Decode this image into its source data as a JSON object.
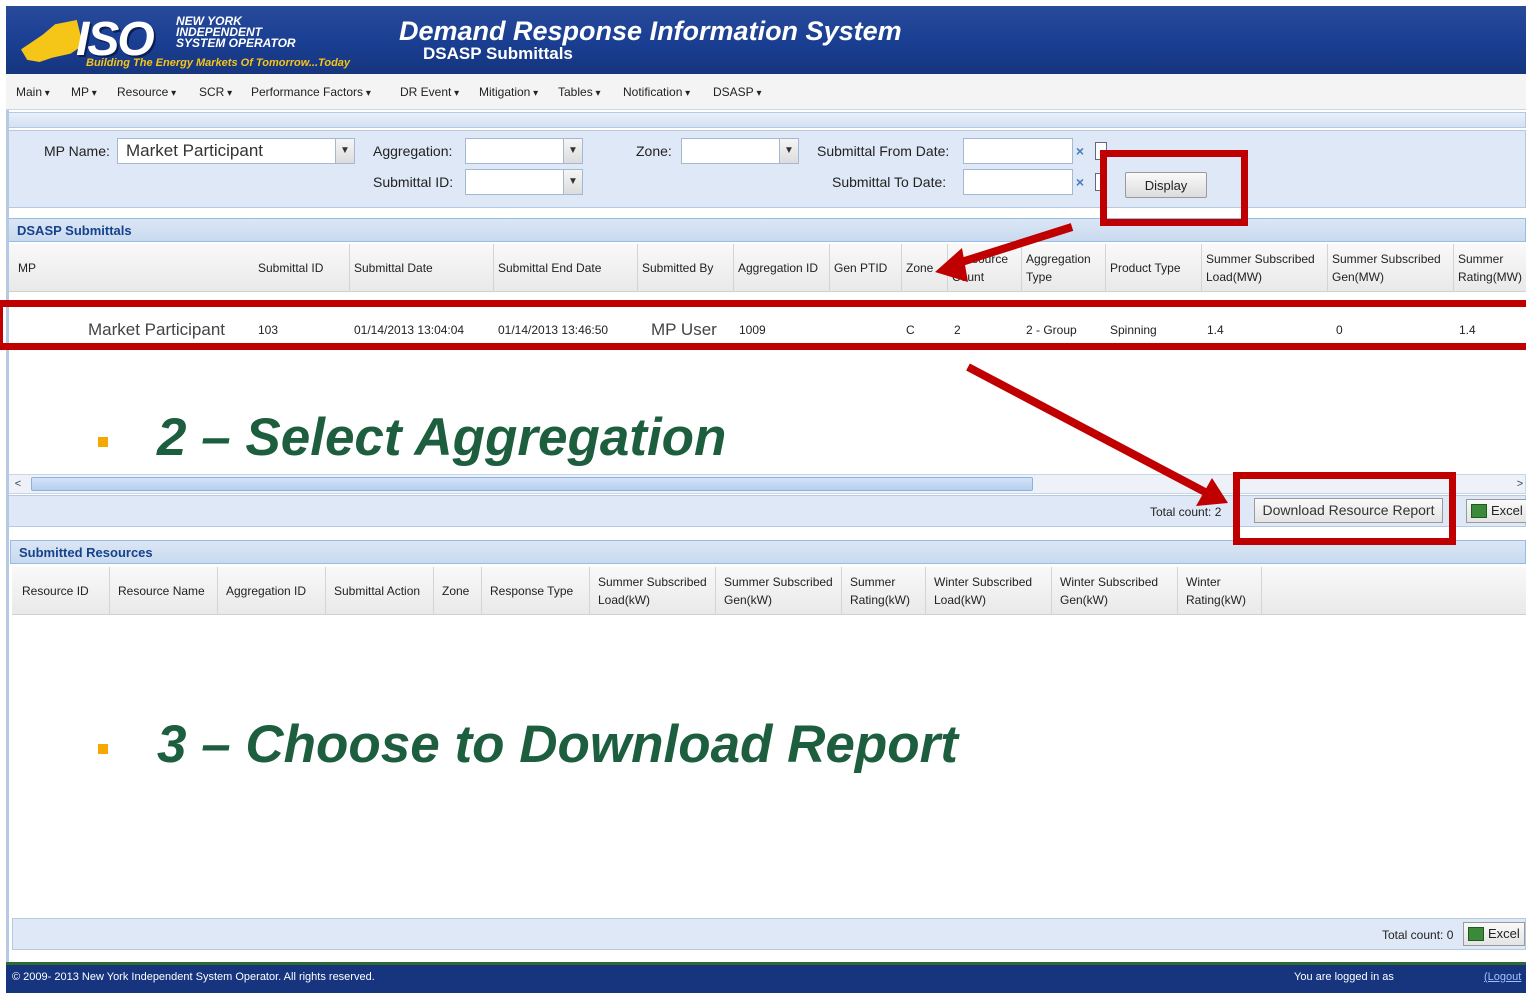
{
  "header": {
    "logo_text": "ISO",
    "logo_org_line1": "NEW YORK",
    "logo_org_line2": "INDEPENDENT",
    "logo_org_line3": "SYSTEM OPERATOR",
    "logo_tagline": "Building The Energy Markets Of Tomorrow...Today",
    "title": "Demand Response Information System",
    "subtitle": "DSASP Submittals"
  },
  "menu": [
    "Main",
    "MP",
    "Resource",
    "SCR",
    "Performance Factors",
    "DR Event",
    "Mitigation",
    "Tables",
    "Notification",
    "DSASP"
  ],
  "filters": {
    "mp_name_label": "MP Name:",
    "mp_name_value": "Market Participant",
    "aggregation_label": "Aggregation:",
    "aggregation_value": "",
    "submittal_id_label": "Submittal ID:",
    "submittal_id_value": "",
    "zone_label": "Zone:",
    "zone_value": "",
    "from_date_label": "Submittal From Date:",
    "from_date_value": "",
    "to_date_label": "Submittal To Date:",
    "to_date_value": "",
    "display_button": "Display"
  },
  "submittals": {
    "title": "DSASP Submittals",
    "columns": [
      "MP",
      "Submittal ID",
      "Submittal Date",
      "Submittal End Date",
      "Submitted By",
      "Aggregation ID",
      "Gen PTID",
      "Zone",
      "Resource Count",
      "Aggregation Type",
      "Product Type",
      "Summer Subscribed Load(MW)",
      "Summer Subscribed Gen(MW)",
      "Summer Rating(MW)"
    ],
    "col_resource_count_a": "source",
    "col_resource_count_b": "Count",
    "col_agg_type_a": "Aggregation",
    "col_agg_type_b": "Type",
    "col_ssl_a": "Summer Subscribed",
    "col_ssl_b": "Load(MW)",
    "col_ssg_a": "Summer Subscribed",
    "col_ssg_b": "Gen(MW)",
    "col_sr_a": "Summer",
    "col_sr_b": "Rating(MW)",
    "rows": [
      {
        "mp": "Market Participant",
        "submittal_id": "103",
        "submittal_date": "01/14/2013 13:04:04",
        "end_date": "01/14/2013 13:46:50",
        "submitted_by": "MP User",
        "aggregation_id": "1009",
        "gen_ptid": "",
        "zone": "C",
        "resource_count": "2",
        "aggregation_type": "2 - Group",
        "product_type": "Spinning",
        "ssl": "1.4",
        "ssg": "0",
        "sr": "1.4"
      }
    ],
    "total_count": "Total count: 2",
    "download_button": "Download Resource Report",
    "excel_button": "Excel"
  },
  "resources": {
    "title": "Submitted Resources",
    "columns": [
      "Resource ID",
      "Resource Name",
      "Aggregation ID",
      "Submittal Action",
      "Zone",
      "Response Type"
    ],
    "col_ssl_a": "Summer Subscribed",
    "col_ssl_b": "Load(kW)",
    "col_ssg_a": "Summer Subscribed",
    "col_ssg_b": "Gen(kW)",
    "col_sr_a": "Summer",
    "col_sr_b": "Rating(kW)",
    "col_wsl_a": "Winter Subscribed",
    "col_wsl_b": "Load(kW)",
    "col_wsg_a": "Winter Subscribed",
    "col_wsg_b": "Gen(kW)",
    "col_wr_a": "Winter",
    "col_wr_b": "Rating(kW)",
    "total_count": "Total count: 0",
    "excel_button": "Excel"
  },
  "callouts": {
    "step2": "2 – Select Aggregation",
    "step3": "3 – Choose to Download Report"
  },
  "footer": {
    "copyright": "© 2009- 2013 New York Independent System Operator. All rights reserved.",
    "logged_in": "You are logged in as",
    "logout": "(Logout"
  },
  "colors": {
    "header_blue": "#1a3f93",
    "callout_red": "#c00000",
    "callout_green": "#1d5e3f",
    "bullet_orange": "#f5a800"
  }
}
